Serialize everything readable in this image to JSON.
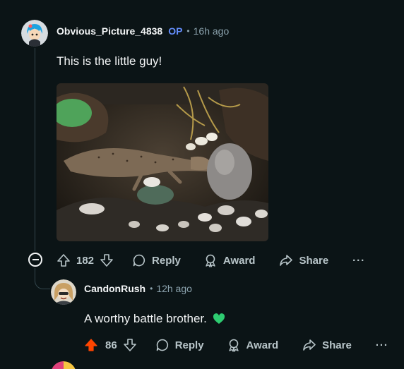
{
  "comment": {
    "author": "Obvious_Picture_4838",
    "op_badge": "OP",
    "separator": "•",
    "time": "16h ago",
    "text": "This is the little guy!",
    "score": "182",
    "reply_label": "Reply",
    "award_label": "Award",
    "share_label": "Share",
    "more_label": "···"
  },
  "reply": {
    "author": "CandonRush",
    "separator": "•",
    "time": "12h ago",
    "text": "A worthy battle brother.",
    "emoji": "💚",
    "score": "86",
    "reply_label": "Reply",
    "award_label": "Award",
    "share_label": "Share",
    "more_label": "···"
  },
  "colors": {
    "background": "#0b1416",
    "op_badge": "#648efc",
    "upvoted": "#ff4500",
    "thread_line": "#33464c"
  },
  "icons": [
    "upvote-icon",
    "downvote-icon",
    "reply-bubble-icon",
    "award-icon",
    "share-arrow-icon",
    "collapse-minus-icon"
  ]
}
